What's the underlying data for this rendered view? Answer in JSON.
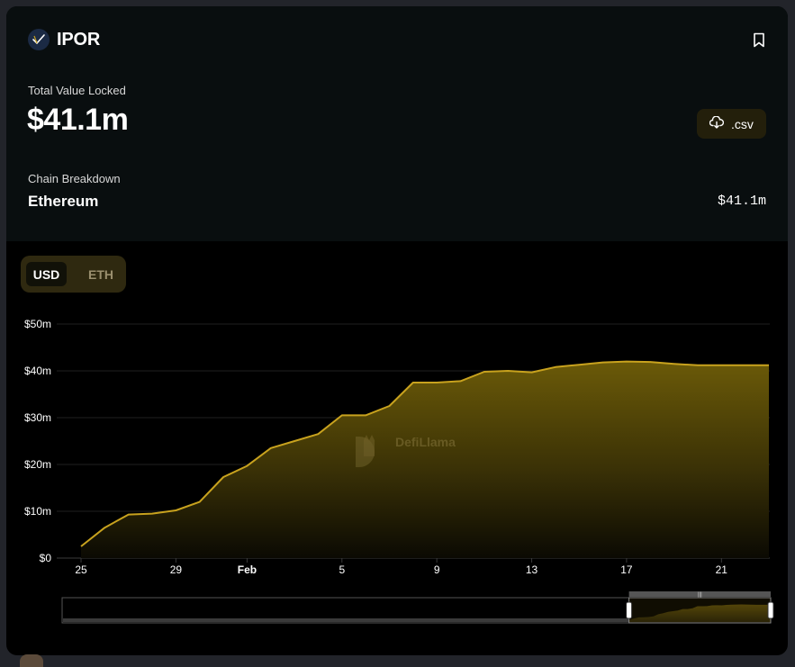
{
  "protocol": {
    "name": "IPOR",
    "logo_icon": "ipor-logo-icon",
    "bookmark_icon": "bookmark-icon"
  },
  "tvl": {
    "label": "Total Value Locked",
    "value": "$41.1m"
  },
  "csv_button": {
    "label": ".csv",
    "icon": "cloud-download-icon"
  },
  "chain_breakdown": {
    "label": "Chain Breakdown",
    "items": [
      {
        "name": "Ethereum",
        "value": "$41.1m"
      }
    ]
  },
  "currency_toggle": {
    "options": [
      "USD",
      "ETH"
    ],
    "selected": "USD"
  },
  "watermark": {
    "text": "DefiLlama"
  },
  "colors": {
    "accent": "#c8a21e",
    "area_top": "#6b5a08",
    "toggle_bg": "#2f2910",
    "csv_bg": "#231f0b"
  },
  "chart_data": {
    "type": "area",
    "x": [
      "Jan 25",
      "Jan 26",
      "Jan 27",
      "Jan 28",
      "Jan 29",
      "Jan 30",
      "Jan 31",
      "Feb 1",
      "Feb 2",
      "Feb 3",
      "Feb 4",
      "Feb 5",
      "Feb 6",
      "Feb 7",
      "Feb 8",
      "Feb 9",
      "Feb 10",
      "Feb 11",
      "Feb 12",
      "Feb 13",
      "Feb 14",
      "Feb 15",
      "Feb 16",
      "Feb 17",
      "Feb 18",
      "Feb 19",
      "Feb 20",
      "Feb 21",
      "Feb 22",
      "Feb 23"
    ],
    "series": [
      {
        "values": [
          2.5,
          6.5,
          9.3,
          9.5,
          10.2,
          12.0,
          17.3,
          19.7,
          23.5,
          25.0,
          26.5,
          30.5,
          30.5,
          32.5,
          37.5,
          37.5,
          37.8,
          39.8,
          40.0,
          39.7,
          40.8,
          41.3,
          41.8,
          42.0,
          41.9,
          41.5,
          41.2,
          41.2,
          41.2,
          41.2
        ]
      }
    ],
    "ylim": [
      0,
      50
    ],
    "y_ticks": [
      "$0",
      "$10m",
      "$20m",
      "$30m",
      "$40m",
      "$50m"
    ],
    "y_tick_values": [
      0,
      10,
      20,
      30,
      40,
      50
    ],
    "x_ticks": [
      "25",
      "29",
      "Feb",
      "5",
      "9",
      "13",
      "17",
      "21"
    ],
    "x_tick_positions": [
      0,
      4,
      7,
      11,
      15,
      19,
      23,
      27
    ],
    "grid": true,
    "legend": "none",
    "unit": "USD",
    "zoom_selection": [
      0.8,
      1.0
    ]
  }
}
